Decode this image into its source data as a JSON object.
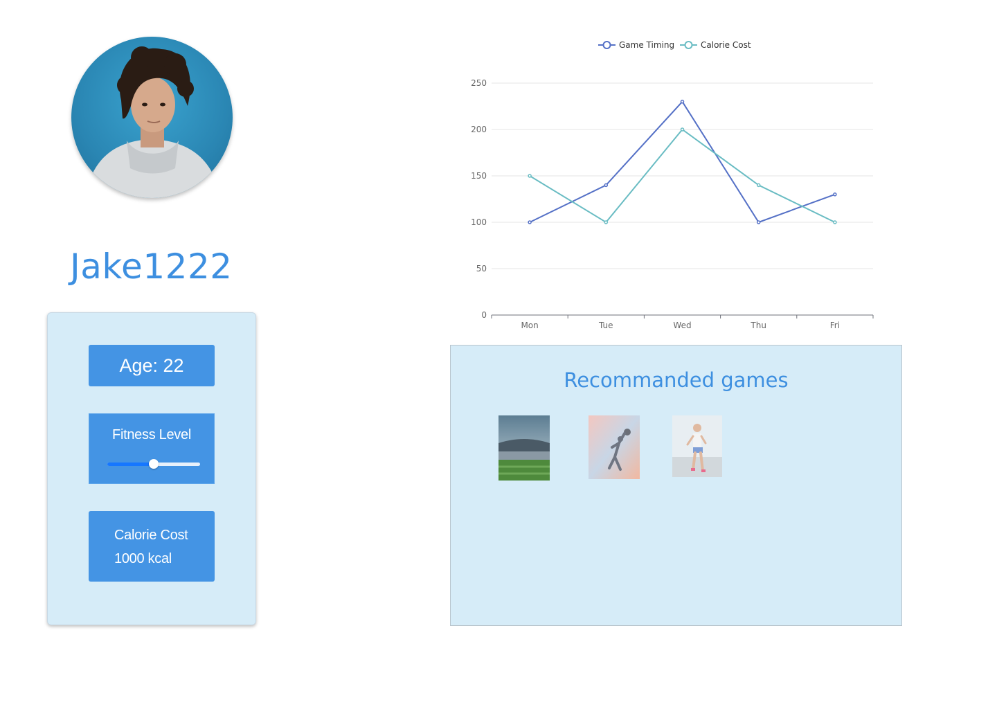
{
  "profile": {
    "username": "Jake1222",
    "avatar_icon": "user-avatar-photo"
  },
  "stats": {
    "age_label": "Age: 22",
    "fitness_label": "Fitness Level",
    "fitness_level": 0.5,
    "calorie_title": "Calorie Cost",
    "calorie_value": "1000 kcal"
  },
  "games": {
    "title": "Recommanded games",
    "items": [
      {
        "icon": "stadium-image"
      },
      {
        "icon": "basketball-player-image"
      },
      {
        "icon": "runner-image"
      }
    ]
  },
  "colors": {
    "accent": "#4494e4",
    "panel_bg": "#d6ecf8",
    "title_blue": "#3d8fe0",
    "series_game_timing": "#5470c6",
    "series_calorie_cost": "#69bcc3"
  },
  "chart_data": {
    "type": "line",
    "categories": [
      "Mon",
      "Tue",
      "Wed",
      "Thu",
      "Fri"
    ],
    "series": [
      {
        "name": "Game Timing",
        "values": [
          100,
          140,
          230,
          100,
          130
        ]
      },
      {
        "name": "Calorie Cost",
        "values": [
          150,
          100,
          200,
          140,
          100
        ]
      }
    ],
    "ylim": [
      0,
      250
    ],
    "yticks": [
      0,
      50,
      100,
      150,
      200,
      250
    ],
    "grid": true,
    "legend_position": "top-center"
  }
}
